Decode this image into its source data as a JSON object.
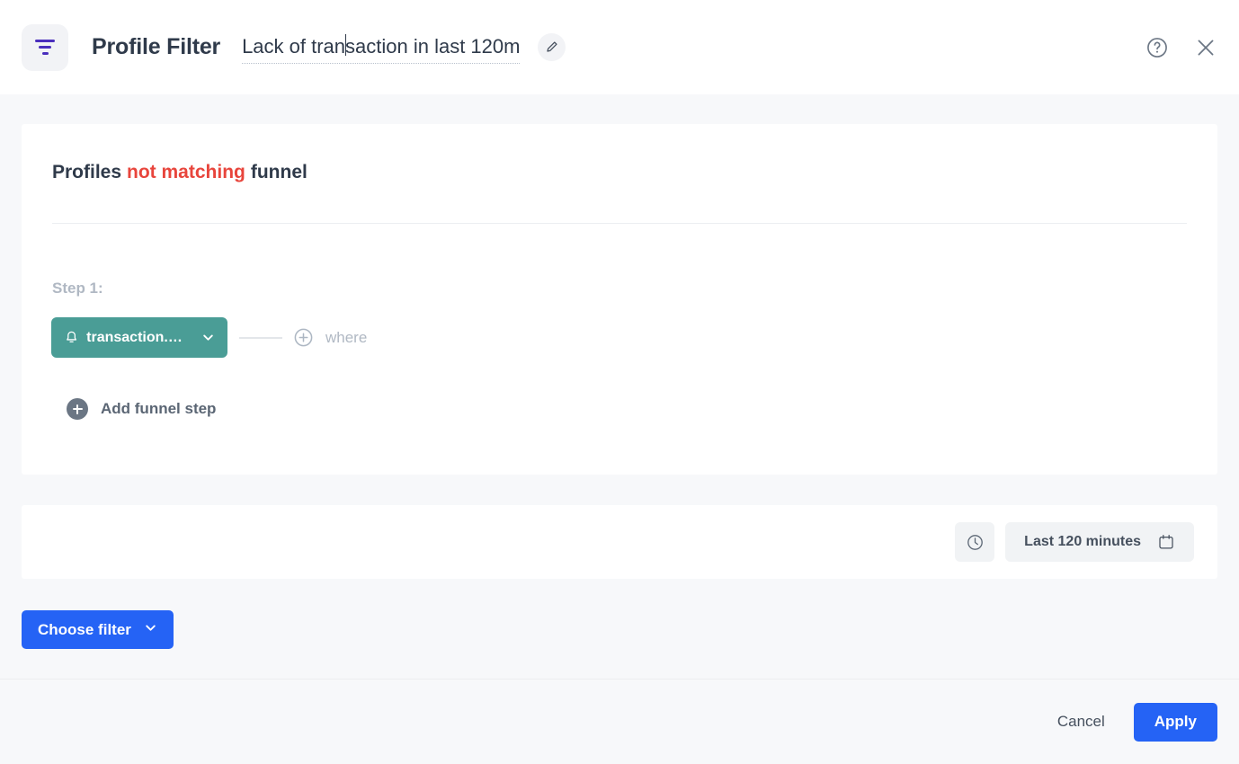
{
  "header": {
    "filter_icon": "filter-icon",
    "app_title": "Profile Filter",
    "filter_name": "Lack of transaction in last 120m",
    "filter_name_before_caret": "Lack of tran",
    "filter_name_after_caret": "saction in last 120m",
    "edit_icon": "pencil-icon",
    "help_icon": "help-circle-icon",
    "close_icon": "close-icon"
  },
  "funnel": {
    "match_prefix": "Profiles",
    "match_condition": "not matching",
    "match_suffix": "funnel",
    "match_condition_color": "#e8453c",
    "step_label": "Step 1:",
    "event": {
      "icon": "bell-icon",
      "name": "transaction.c...",
      "chevron": "chevron-down-icon",
      "color": "#4a9d96"
    },
    "where_label": "where",
    "where_icon": "plus-circle-icon",
    "add_step_label": "Add funnel step",
    "add_step_icon": "plus-circle-filled-icon"
  },
  "time_range": {
    "clock_icon": "clock-icon",
    "range_label": "Last 120 minutes",
    "calendar_icon": "calendar-icon"
  },
  "actions": {
    "choose_filter_label": "Choose filter",
    "choose_filter_chevron": "chevron-down-icon",
    "accent_color": "#2563f5"
  },
  "footer": {
    "cancel_label": "Cancel",
    "apply_label": "Apply"
  }
}
